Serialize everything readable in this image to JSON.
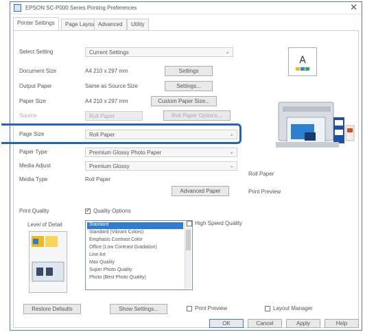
{
  "title": "EPSON SC-P000 Series Printing Preferences",
  "close_glyph": "✕",
  "tabs": [
    "Printer Settings",
    "Page Layout",
    "Advanced",
    "Utility"
  ],
  "rows": [
    {
      "label": "Select Setting",
      "value": "Current Settings",
      "button": ""
    },
    {
      "label": "Document Size",
      "value": "A4 210 x 297 mm",
      "button": "Settings"
    },
    {
      "label": "Output Paper",
      "value": "Same as Source Size",
      "button": "Settings..."
    },
    {
      "label": "Paper Size",
      "value": "A4 210 x 297 mm",
      "button": "Custom Paper Size..."
    },
    {
      "label": "Source",
      "value": "Roll Paper",
      "button": "Roll Paper Options..."
    },
    {
      "label": "Page Size",
      "value": "Roll Paper",
      "button": ""
    },
    {
      "label": "Paper Type",
      "value": "Premium Glossy Photo Paper",
      "button": ""
    },
    {
      "label": "Media Adjust",
      "value": "Premium Glossy",
      "button": ""
    },
    {
      "label": "Media Type",
      "value": "Roll Paper",
      "button": "Advanced Paper"
    }
  ],
  "right_labels": [
    "Roll Paper",
    "Print Preview"
  ],
  "print_quality": {
    "label": "Print Quality",
    "checkbox_label": "Quality Options",
    "level_label": "Level of Detail",
    "options": [
      "Standard",
      "Standard (Vibrant Colors)",
      "Emphasis Contrast Color",
      "Office (Low Contrast Gradation)",
      "Line Art",
      "Max Quality",
      "Super Photo Quality",
      "Photo (Best Photo Quality)"
    ],
    "selected": 0,
    "high_speed_label": "High Speed Quality"
  },
  "footer": {
    "restore_button": "Restore Defaults",
    "show_settings_button": "Show Settings...",
    "preview_checkbox": "Print Preview",
    "layout_checkbox": "Layout Manager",
    "ok": "OK",
    "cancel": "Cancel",
    "apply": "Apply",
    "help": "Help"
  }
}
